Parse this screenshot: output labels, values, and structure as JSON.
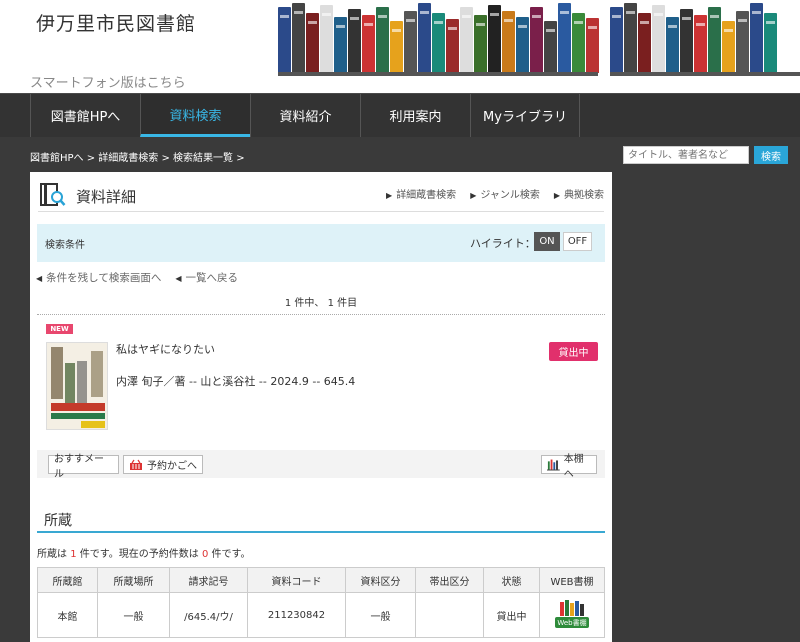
{
  "header": {
    "site_title": "伊万里市民図書館",
    "sp_link": "スマートフォン版はこちら"
  },
  "nav": {
    "items": [
      {
        "label": "図書館HPへ"
      },
      {
        "label": "資料検索"
      },
      {
        "label": "資料紹介"
      },
      {
        "label": "利用案内"
      },
      {
        "label": "Myライブラリ"
      }
    ]
  },
  "breadcrumb": "図書館HPへ > 詳細蔵書検索 > 検索結果一覧 >",
  "search": {
    "placeholder": "タイトル、著者名など",
    "button": "検索"
  },
  "detail": {
    "title": "資料詳細",
    "links": [
      "詳細蔵書検索",
      "ジャンル検索",
      "典拠検索"
    ],
    "condition_label": "検索条件",
    "highlight_label": "ハイライト：",
    "on": "ON",
    "off": "OFF",
    "back_search": "条件を残して検索画面へ",
    "back_list": "一覧へ戻る",
    "count": "1 件中、 1 件目"
  },
  "book": {
    "new_badge": "NEW",
    "title": "私はヤギになりたい",
    "meta": "内澤 旬子／著 -- 山と溪谷社 -- 2024.9 -- 645.4",
    "status": "貸出中"
  },
  "actions": {
    "mail": "おすすメール",
    "cart": "予約かごへ",
    "shelf": "本棚へ"
  },
  "holdings": {
    "title": "所蔵",
    "summary_prefix": "所蔵は",
    "count": "1",
    "summary_mid": "件です。現在の予約件数は",
    "reserve": "0",
    "summary_suffix": "件です。",
    "headers": [
      "所蔵館",
      "所蔵場所",
      "請求記号",
      "資料コード",
      "資料区分",
      "帯出区分",
      "状態",
      "WEB書棚"
    ],
    "rows": [
      [
        "本館",
        "一般",
        "/645.4/ウ/",
        "211230842",
        "一般",
        "",
        "貸出中",
        "Web書棚"
      ]
    ]
  },
  "colors": {
    "accent": "#39b7e6",
    "badge": "#e1306c"
  }
}
